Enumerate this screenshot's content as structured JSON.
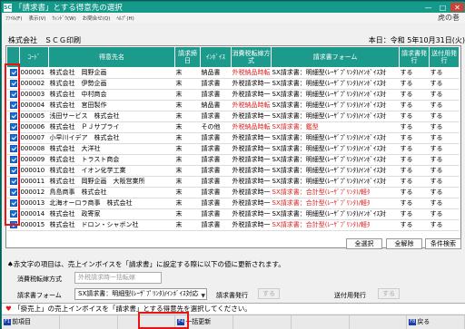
{
  "window": {
    "title": "「請求書」とする得意先の選択",
    "icon": "app-icon"
  },
  "menu": [
    "ﾌｧｲﾙ(F)",
    "表示(V)",
    "ｳｨﾝﾄﾞｳ(W)",
    "お問合せ(Q)",
    "ﾍﾙﾌﾟ(H)"
  ],
  "menu_right": "虎の巻",
  "company": "株式会社　ＳＣＧ印刷",
  "date": "本日：令和 5年10月31日(火)",
  "columns": [
    "",
    "ｺｰﾄﾞ",
    "得意先名",
    "請求締日",
    "ｲﾝﾎﾞｲｽ",
    "消費税転嫁方式",
    "請求書フォーム",
    "請求書発行",
    "送付用発行"
  ],
  "rows": [
    {
      "code": "000001",
      "name": "株式会社　岡野企画",
      "close": "末",
      "invoice": "納品書",
      "tax": "外税納品時転",
      "tax_red": true,
      "form": "SX請求書：明細型(ﾚｰｻﾞﾌﾟﾘﾝﾀ)/ｲﾝﾎﾞｲｽ対",
      "form_red": false,
      "issue": "する",
      "send": "する"
    },
    {
      "code": "000002",
      "name": "株式会社　伊勢企画",
      "close": "末",
      "invoice": "請求書",
      "tax": "外税請求時一",
      "tax_red": false,
      "form": "SX請求書：明細型(ﾚｰｻﾞﾌﾟﾘﾝﾀ)/ｲﾝﾎﾞｲｽ対",
      "form_red": false,
      "issue": "する",
      "send": "する"
    },
    {
      "code": "000003",
      "name": "株式会社　中村商会",
      "close": "末",
      "invoice": "請求書",
      "tax": "外税請求時一",
      "tax_red": false,
      "form": "SX請求書：明細型(ﾚｰｻﾞﾌﾟﾘﾝﾀ)/ｲﾝﾎﾞｲｽ対",
      "form_red": false,
      "issue": "する",
      "send": "する"
    },
    {
      "code": "000004",
      "name": "株式会社　宮田製作",
      "close": "末",
      "invoice": "納品書",
      "tax": "外税納品時転",
      "tax_red": true,
      "form": "SX請求書：明細型(ﾚｰｻﾞﾌﾟﾘﾝﾀ)/ｲﾝﾎﾞｲｽ対",
      "form_red": false,
      "issue": "する",
      "send": "する"
    },
    {
      "code": "000005",
      "name": "浅田サービス　株式会社",
      "close": "末",
      "invoice": "請求書",
      "tax": "外税請求時一",
      "tax_red": false,
      "form": "SX請求書：明細型(ﾚｰｻﾞﾌﾟﾘﾝﾀ)/ｲﾝﾎﾞｲｽ対",
      "form_red": false,
      "issue": "する",
      "send": "する"
    },
    {
      "code": "000006",
      "name": "株式会社　ＰＪサプライ",
      "close": "末",
      "invoice": "その他",
      "tax": "外税納品時転",
      "tax_red": true,
      "form": "SX請求書：鑑型",
      "form_red": true,
      "issue": "する",
      "send": "する"
    },
    {
      "code": "000007",
      "name": "小早川イデア　株式会社",
      "close": "末",
      "invoice": "請求書",
      "tax": "外税請求時一",
      "tax_red": false,
      "form": "SX請求書：明細型(ﾚｰｻﾞﾌﾟﾘﾝﾀ)/ｲﾝﾎﾞｲｽ対",
      "form_red": false,
      "issue": "する",
      "send": "する"
    },
    {
      "code": "000008",
      "name": "株式会社　大洋社",
      "close": "末",
      "invoice": "請求書",
      "tax": "外税請求時一",
      "tax_red": false,
      "form": "SX請求書：明細型(ﾚｰｻﾞﾌﾟﾘﾝﾀ)/ｲﾝﾎﾞｲｽ対",
      "form_red": false,
      "issue": "する",
      "send": "する"
    },
    {
      "code": "000009",
      "name": "株式会社　トラスト商会",
      "close": "末",
      "invoice": "請求書",
      "tax": "外税請求時一",
      "tax_red": false,
      "form": "SX請求書：明細型(ﾚｰｻﾞﾌﾟﾘﾝﾀ)/ｲﾝﾎﾞｲｽ対",
      "form_red": false,
      "issue": "する",
      "send": "する"
    },
    {
      "code": "000010",
      "name": "株式会社　イオン化学工業",
      "close": "末",
      "invoice": "請求書",
      "tax": "外税請求時一",
      "tax_red": false,
      "form": "SX請求書：明細型(ﾚｰｻﾞﾌﾟﾘﾝﾀ)/ｲﾝﾎﾞｲｽ対",
      "form_red": false,
      "issue": "する",
      "send": "する"
    },
    {
      "code": "000011",
      "name": "株式会社　岡野企画　大阪営業所",
      "close": "末",
      "invoice": "請求書",
      "tax": "外税請求時一",
      "tax_red": false,
      "form": "SX請求書：明細型(ﾚｰｻﾞﾌﾟﾘﾝﾀ)/ｲﾝﾎﾞｲｽ対",
      "form_red": false,
      "issue": "する",
      "send": "する"
    },
    {
      "code": "000012",
      "name": "鳥島商事　株式会社",
      "close": "末",
      "invoice": "請求書",
      "tax": "外税請求時一",
      "tax_red": false,
      "form": "SX請求書：合計型(ﾚｰｻﾞﾌﾟﾘﾝﾀ)/軽ﾀ",
      "form_red": true,
      "issue": "する",
      "send": "する"
    },
    {
      "code": "000013",
      "name": "北海オーロラ商事　株式会社",
      "close": "末",
      "invoice": "請求書",
      "tax": "外税請求時一",
      "tax_red": false,
      "form": "SX請求書：合計型(ﾚｰｻﾞﾌﾟﾘﾝﾀ)/軽ﾀ",
      "form_red": true,
      "issue": "する",
      "send": "する"
    },
    {
      "code": "000014",
      "name": "株式会社　政寄家",
      "close": "末",
      "invoice": "請求書",
      "tax": "外税請求時一",
      "tax_red": false,
      "form": "SX請求書：明細型(ﾚｰｻﾞﾌﾟﾘﾝﾀ)/ｲﾝﾎﾞｲｽ対",
      "form_red": false,
      "issue": "する",
      "send": "する"
    },
    {
      "code": "000015",
      "name": "株式会社　ドロン・シャボン社",
      "close": "末",
      "invoice": "請求書",
      "tax": "外税請求時一",
      "tax_red": false,
      "form": "SX請求書：合計型(ﾚｰｻﾞﾌﾟﾘﾝﾀ)/軽ﾀ",
      "form_red": true,
      "issue": "する",
      "send": "する"
    }
  ],
  "buttons": {
    "select_all": "全選択",
    "clear_all": "全解除",
    "search": "条件検索"
  },
  "note": "♠赤文字の項目は、売上インボイスを「請求書」に設定する際に以下の値に更新されます。",
  "tax_label": "消費税転嫁方式",
  "tax_value": "外税請求時一括転嫁",
  "form_label": "請求書フォーム",
  "form_value": "SX請求書：明細型(ﾚｰｻﾞﾌﾟﾘﾝﾀ)/ｲﾝﾎﾞｲｽ対応",
  "issue_label": "請求書発行",
  "issue_value": "する",
  "send_label": "送付用発行",
  "send_value": "する",
  "status": "「掛売上」の売上インボイスを「請求書」とする得意先を選択してください。",
  "fkeys": {
    "f1_tag": "F1",
    "f1": "前項目",
    "f4_tag": "F4",
    "f4": "一括更新",
    "f8_tag": "F8",
    "f8": "戻る"
  }
}
